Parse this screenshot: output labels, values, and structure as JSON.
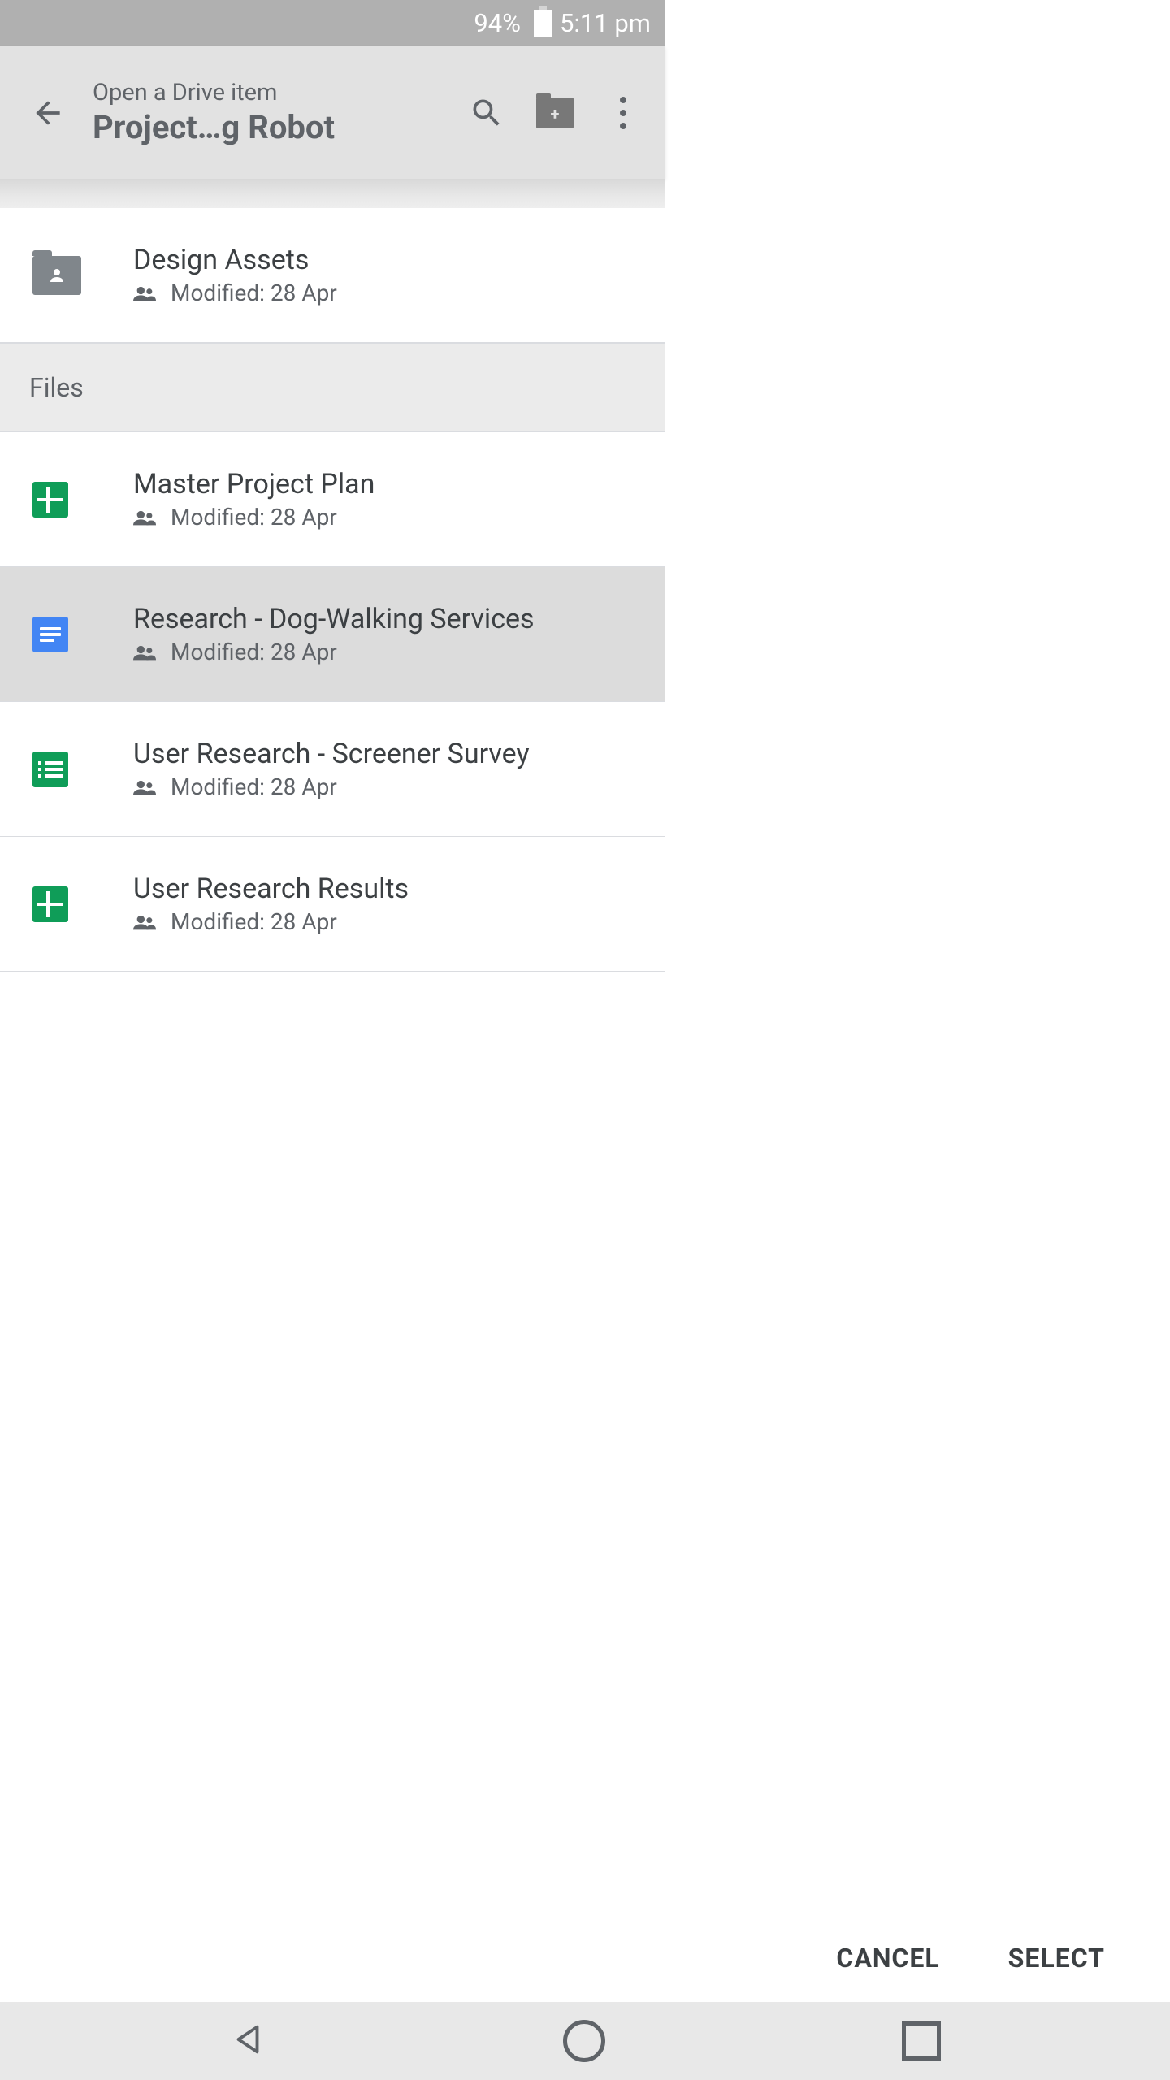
{
  "status": {
    "battery_pct": "94%",
    "time": "5:11 pm"
  },
  "appbar": {
    "subtitle": "Open a Drive item",
    "title": "Project…g Robot"
  },
  "folders": [
    {
      "name": "Design Assets",
      "meta": "Modified: 28 Apr"
    }
  ],
  "section_label": "Files",
  "files": [
    {
      "name": "Master Project Plan",
      "meta": "Modified: 28 Apr",
      "type": "sheets",
      "selected": false
    },
    {
      "name": "Research - Dog-Walking Services",
      "meta": "Modified: 28 Apr",
      "type": "docs",
      "selected": true
    },
    {
      "name": "User Research - Screener Survey",
      "meta": "Modified: 28 Apr",
      "type": "form",
      "selected": false
    },
    {
      "name": "User Research Results",
      "meta": "Modified: 28 Apr",
      "type": "sheets",
      "selected": false
    }
  ],
  "actions": {
    "cancel": "CANCEL",
    "select": "SELECT"
  }
}
